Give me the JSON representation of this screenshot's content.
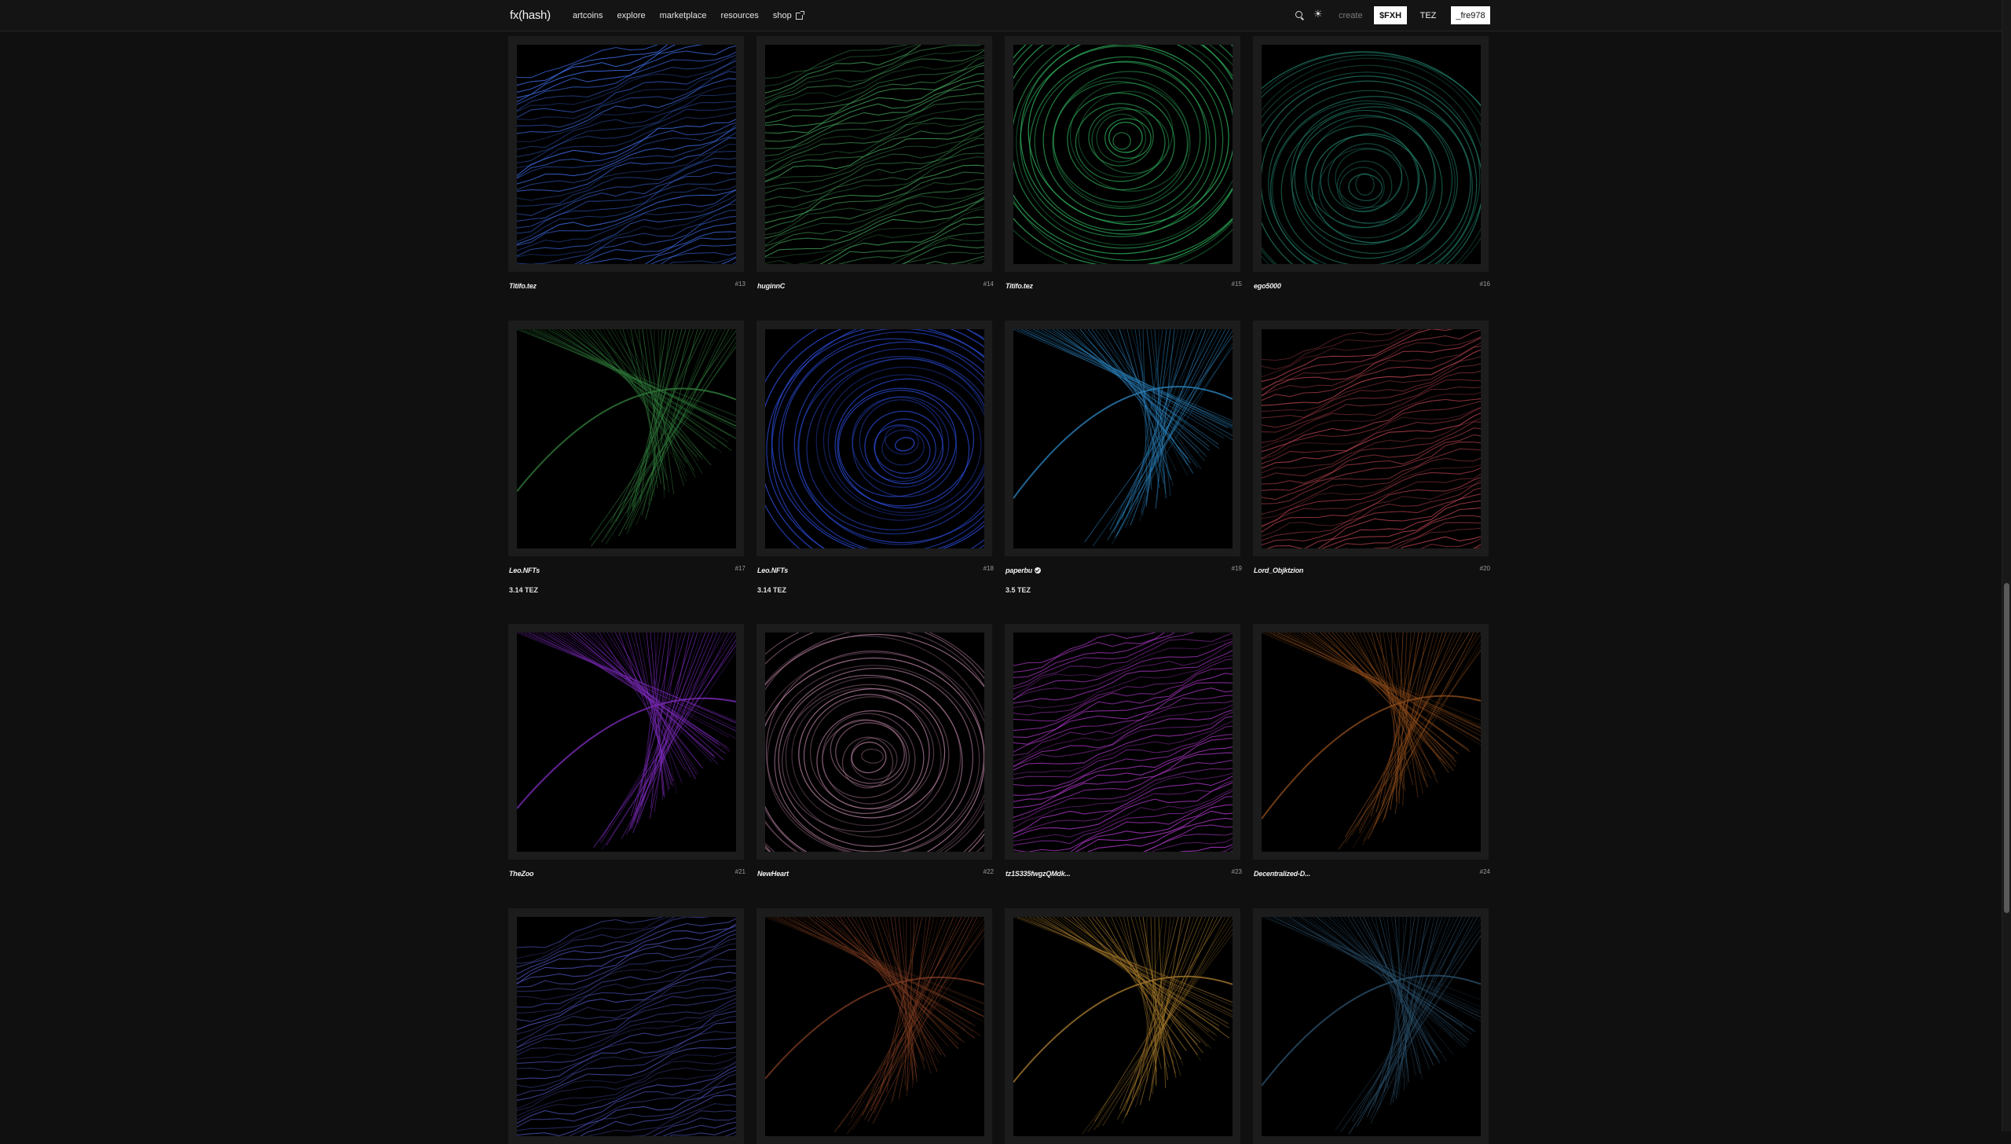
{
  "nav": {
    "logo": "fx(hash)",
    "items": [
      "artcoins",
      "explore",
      "marketplace",
      "resources",
      "shop"
    ],
    "create": "create",
    "currency_fxh": "$FXH",
    "currency_tez": "TEZ",
    "user": "_fre978"
  },
  "colors": {
    "background": "#101010",
    "card_bg": "#1c1c1c",
    "accent_white": "#ffffff"
  },
  "cards": [
    {
      "author": "Titifo.tez",
      "iteration": "#13",
      "price": "",
      "art_color": "#3a66d8",
      "pattern": "waves"
    },
    {
      "author": "huginnC",
      "iteration": "#14",
      "price": "",
      "art_color": "#3f9a55",
      "pattern": "waves"
    },
    {
      "author": "Titifo.tez",
      "iteration": "#15",
      "price": "",
      "art_color": "#2fb05c",
      "pattern": "rings"
    },
    {
      "author": "ego5000",
      "iteration": "#16",
      "price": "",
      "art_color": "#1f7a66",
      "pattern": "rings"
    },
    {
      "author": "Leo.NFTs",
      "iteration": "#17",
      "price": "3.14 TEZ",
      "art_color": "#2f7a3a",
      "pattern": "lines"
    },
    {
      "author": "Leo.NFTs",
      "iteration": "#18",
      "price": "3.14 TEZ",
      "art_color": "#2c4ee0",
      "pattern": "rings"
    },
    {
      "author": "paperbu",
      "iteration": "#19",
      "price": "3.5 TEZ",
      "art_color": "#2a7fb8",
      "pattern": "lines",
      "verified": true
    },
    {
      "author": "Lord_Objktzion",
      "iteration": "#20",
      "price": "",
      "art_color": "#b8434f",
      "pattern": "waves"
    },
    {
      "author": "TheZoo",
      "iteration": "#21",
      "price": "",
      "art_color": "#7a2ab8",
      "pattern": "lines"
    },
    {
      "author": "NewHeart",
      "iteration": "#22",
      "price": "",
      "art_color": "#b07a9a",
      "pattern": "rings"
    },
    {
      "author": "tz1S335fwgzQMdk...",
      "iteration": "#23",
      "price": "",
      "art_color": "#b53ad0",
      "pattern": "waves"
    },
    {
      "author": "Decentralized-D...",
      "iteration": "#24",
      "price": "",
      "art_color": "#8a4a1a",
      "pattern": "lines"
    },
    {
      "author": "",
      "iteration": "",
      "price": "",
      "art_color": "#4a4fb0",
      "pattern": "waves"
    },
    {
      "author": "",
      "iteration": "",
      "price": "",
      "art_color": "#7a3a20",
      "pattern": "lines"
    },
    {
      "author": "",
      "iteration": "",
      "price": "",
      "art_color": "#a0762a",
      "pattern": "lines"
    },
    {
      "author": "",
      "iteration": "",
      "price": "",
      "art_color": "#2a4f6a",
      "pattern": "lines"
    }
  ]
}
